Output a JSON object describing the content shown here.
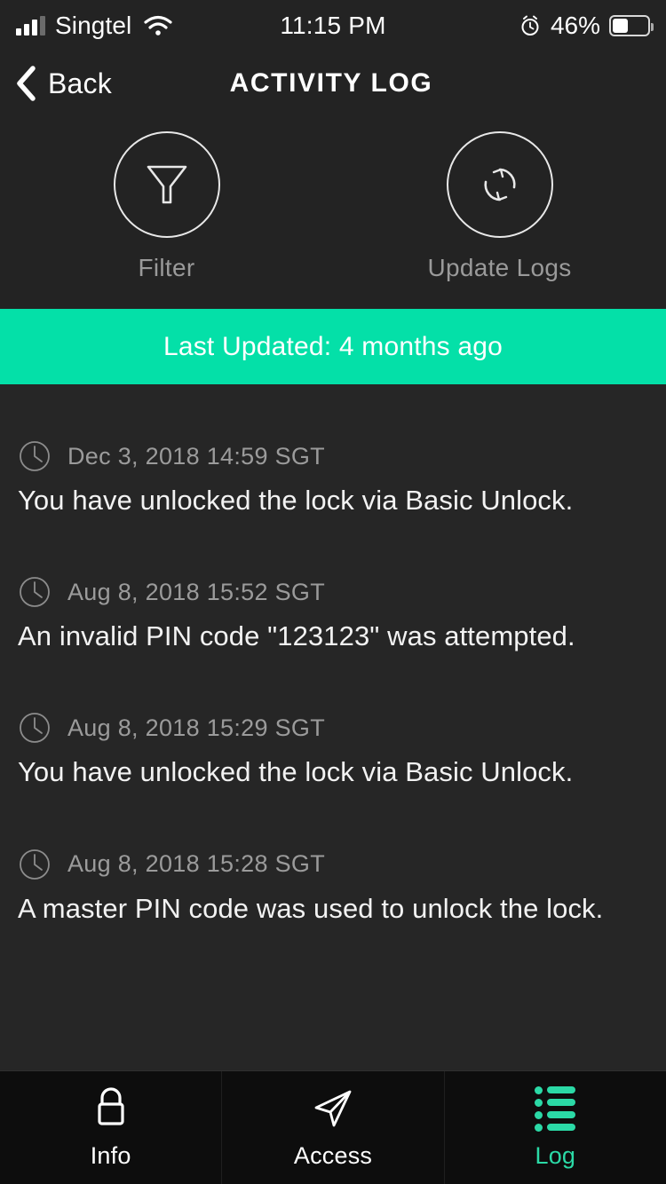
{
  "status_bar": {
    "carrier": "Singtel",
    "time": "11:15 PM",
    "battery_percent": "46%",
    "signal_icon": "signal-bars-icon",
    "wifi_icon": "wifi-icon",
    "alarm_icon": "alarm-clock-icon",
    "battery_icon": "battery-icon"
  },
  "nav": {
    "back_label": "Back",
    "back_icon": "chevron-left-icon",
    "title": "ACTIVITY LOG"
  },
  "actions": [
    {
      "label": "Filter",
      "icon": "funnel-filter-icon"
    },
    {
      "label": "Update Logs",
      "icon": "refresh-sync-icon"
    }
  ],
  "banner": {
    "text": "Last Updated: 4 months ago",
    "color": "#04E0A8",
    "text_color": "#ffffff"
  },
  "log": {
    "entry_icon": "clock-icon",
    "entries": [
      {
        "timestamp": "Dec 3, 2018 14:59 SGT",
        "message": "You have unlocked the lock via Basic Unlock."
      },
      {
        "timestamp": "Aug 8, 2018 15:52 SGT",
        "message": "An invalid PIN code \"123123\" was attempted."
      },
      {
        "timestamp": "Aug 8, 2018 15:29 SGT",
        "message": "You have unlocked the lock via Basic Unlock."
      },
      {
        "timestamp": "Aug 8, 2018 15:28 SGT",
        "message": "A master PIN code was used to unlock the lock."
      }
    ]
  },
  "tabs": [
    {
      "label": "Info",
      "icon": "padlock-icon",
      "active": false
    },
    {
      "label": "Access",
      "icon": "paper-plane-icon",
      "active": false
    },
    {
      "label": "Log",
      "icon": "list-icon",
      "active": true
    }
  ],
  "colors": {
    "accent": "#2BD9A6",
    "banner": "#04E0A8",
    "background": "#262626",
    "header_background": "#232323",
    "tabbar_background": "#0D0D0D",
    "muted_text": "#9a9a9a"
  }
}
